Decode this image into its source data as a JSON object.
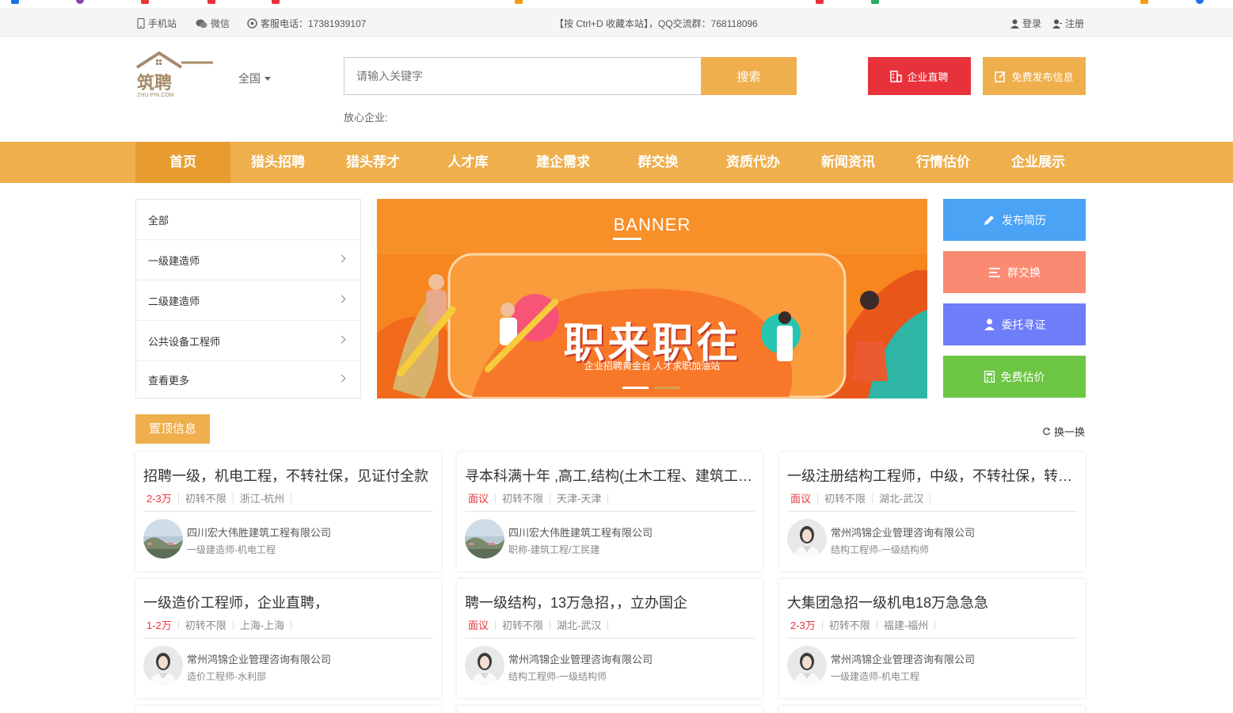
{
  "topbar": {
    "mobile": "手机站",
    "wechat": "微信",
    "hotline": "客服电话：17381939107",
    "notice": "【按 Ctrl+D 收藏本站】，QQ交流群：768118096",
    "login": "登录",
    "register": "注册"
  },
  "header": {
    "logo_text": "筑聘",
    "logo_sub": "ZHU-PIN.COM",
    "region": "全国",
    "search_placeholder": "请输入关键字",
    "search_button": "搜索",
    "trust_label": "放心企业:",
    "direct_hire": "企业直聘",
    "free_publish": "免费发布信息"
  },
  "nav": {
    "items": [
      "首页",
      "猎头招聘",
      "猎头荐才",
      "人才库",
      "建企需求",
      "群交换",
      "资质代办",
      "新闻资讯",
      "行情估价",
      "企业展示"
    ]
  },
  "categories": {
    "items": [
      "全部",
      "一级建造师",
      "二级建造师",
      "公共设备工程师",
      "查看更多"
    ]
  },
  "banner": {
    "label": "BANNER",
    "headline": "职来职往",
    "sub": "企业招聘黄金台 人才求职加油站"
  },
  "quick": {
    "items": [
      {
        "label": "发布简历",
        "color": "#4aa3f5"
      },
      {
        "label": "群交换",
        "color": "#fb8a73"
      },
      {
        "label": "委托寻证",
        "color": "#6e7dfa"
      },
      {
        "label": "免费估价",
        "color": "#6cc644"
      }
    ]
  },
  "section": {
    "title": "置顶信息",
    "refresh": "换一换"
  },
  "jobs": [
    {
      "title": "招聘一级，机电工程，不转社保，见证付全款",
      "salary": "2-3万",
      "type": "初转不限",
      "location": "浙江-杭州",
      "company": "四川宏大伟胜建筑工程有限公司",
      "tags": "一级建造师-机电工程",
      "avatar": "landscape"
    },
    {
      "title": "寻本科满十年 ,高工,结构(土木工程、建筑工程)",
      "salary": "面议",
      "type": "初转不限",
      "location": "天津-天津",
      "company": "四川宏大伟胜建筑工程有限公司",
      "tags": "职称-建筑工程/工民建",
      "avatar": "landscape"
    },
    {
      "title": "一级注册结构工程师，中级，不转社保，转注册",
      "salary": "面议",
      "type": "初转不限",
      "location": "湖北-武汉",
      "company": "常州鸿锦企业管理咨询有限公司",
      "tags": "结构工程师-一级结构师",
      "avatar": "person"
    },
    {
      "title": "一级造价工程师，企业直聘，",
      "salary": "1-2万",
      "type": "初转不限",
      "location": "上海-上海",
      "company": "常州鸿锦企业管理咨询有限公司",
      "tags": "造价工程师-水利部",
      "avatar": "person"
    },
    {
      "title": "聘一级结构，13万急招，，立办国企",
      "salary": "面议",
      "type": "初转不限",
      "location": "湖北-武汉",
      "company": "常州鸿锦企业管理咨询有限公司",
      "tags": "结构工程师-一级结构师",
      "avatar": "person"
    },
    {
      "title": "大集团急招一级机电18万急急急",
      "salary": "2-3万",
      "type": "初转不限",
      "location": "福建-福州",
      "company": "常州鸿锦企业管理咨询有限公司",
      "tags": "一级建造师-机电工程",
      "avatar": "person"
    }
  ]
}
